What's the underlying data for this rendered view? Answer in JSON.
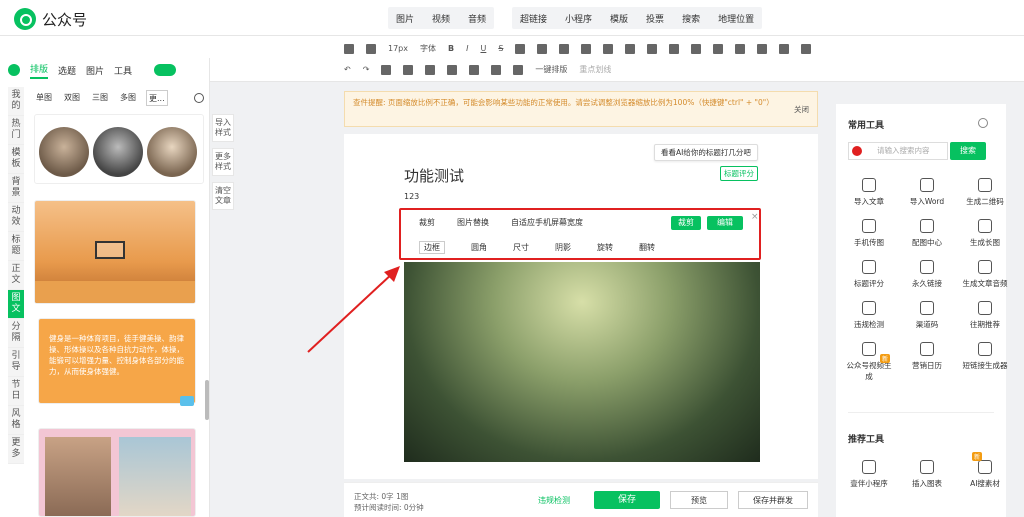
{
  "app": {
    "title": "公众号"
  },
  "top_menu": {
    "group1": [
      "图片",
      "视频",
      "音频"
    ],
    "group2": [
      "超链接",
      "小程序",
      "模版",
      "投票",
      "搜索",
      "地理位置"
    ]
  },
  "toolbar": {
    "font_size": "17px",
    "font_label": "字体",
    "one_key_layout": "一键排版",
    "clear_separators": "重点划线"
  },
  "left_panel": {
    "tabs": [
      "排版",
      "选题",
      "图片",
      "工具"
    ],
    "sub_tabs": [
      "单图",
      "双图",
      "三图",
      "多图",
      "更..."
    ],
    "vertical_nav": [
      "我的",
      "热门",
      "模板",
      "背景",
      "动效",
      "标题",
      "正文",
      "图文",
      "分隔",
      "引导",
      "节日",
      "风格",
      "更多"
    ],
    "active_nav": "图文",
    "card_text": "健身是一种体育项目，徒手健美操、韵律操、形体操以及各种自抗力动作，体操，能锻可以增强力量、控制身体各部分的能力，从而使身体强健。"
  },
  "mid_tools": [
    "导入样式",
    "更多样式",
    "清空文章"
  ],
  "warning": {
    "text": "查件提醒: 页面缩放比例不正确，可能会影响某些功能的正常使用。请尝试调整浏览器缩放比例为100%（快捷键\"ctrl\" + \"0\"）",
    "close_label": "关闭"
  },
  "editor": {
    "ai_hint": "看看AI给你的标题打几分吧",
    "title": "功能测试",
    "title_score": "标题评分",
    "body": "123",
    "img_toolbar_row1": [
      "裁剪",
      "图片替换",
      "自适应手机屏幕宽度"
    ],
    "crop_btn": "裁剪",
    "edit_btn": "编辑",
    "img_toolbar_row2": [
      "边框",
      "圆角",
      "尺寸",
      "阴影",
      "旋转",
      "翻转"
    ]
  },
  "bottom_bar": {
    "stats1": "正文共: 0字 1图",
    "stats2": "预计阅读时间: 0分钟",
    "check": "违规检测",
    "save": "保存",
    "preview": "预览",
    "save_mass": "保存并群发"
  },
  "right_panel": {
    "common_title": "常用工具",
    "search_placeholder": "请输入搜索内容",
    "search_btn": "搜索",
    "tools": [
      "导入文章",
      "导入Word",
      "生成二维码",
      "手机传图",
      "配图中心",
      "生成长图",
      "标题评分",
      "永久链接",
      "生成文章音频",
      "违规检测",
      "渠道码",
      "往期推荐",
      "公众号视频生成",
      "营销日历",
      "短链接生成器"
    ],
    "recommend_title": "推荐工具",
    "recommend": [
      "壹伴小程序",
      "插入图表",
      "AI搜素材"
    ],
    "new_badge": "新"
  },
  "colors": {
    "accent": "#07c160",
    "highlight": "#e02020"
  }
}
